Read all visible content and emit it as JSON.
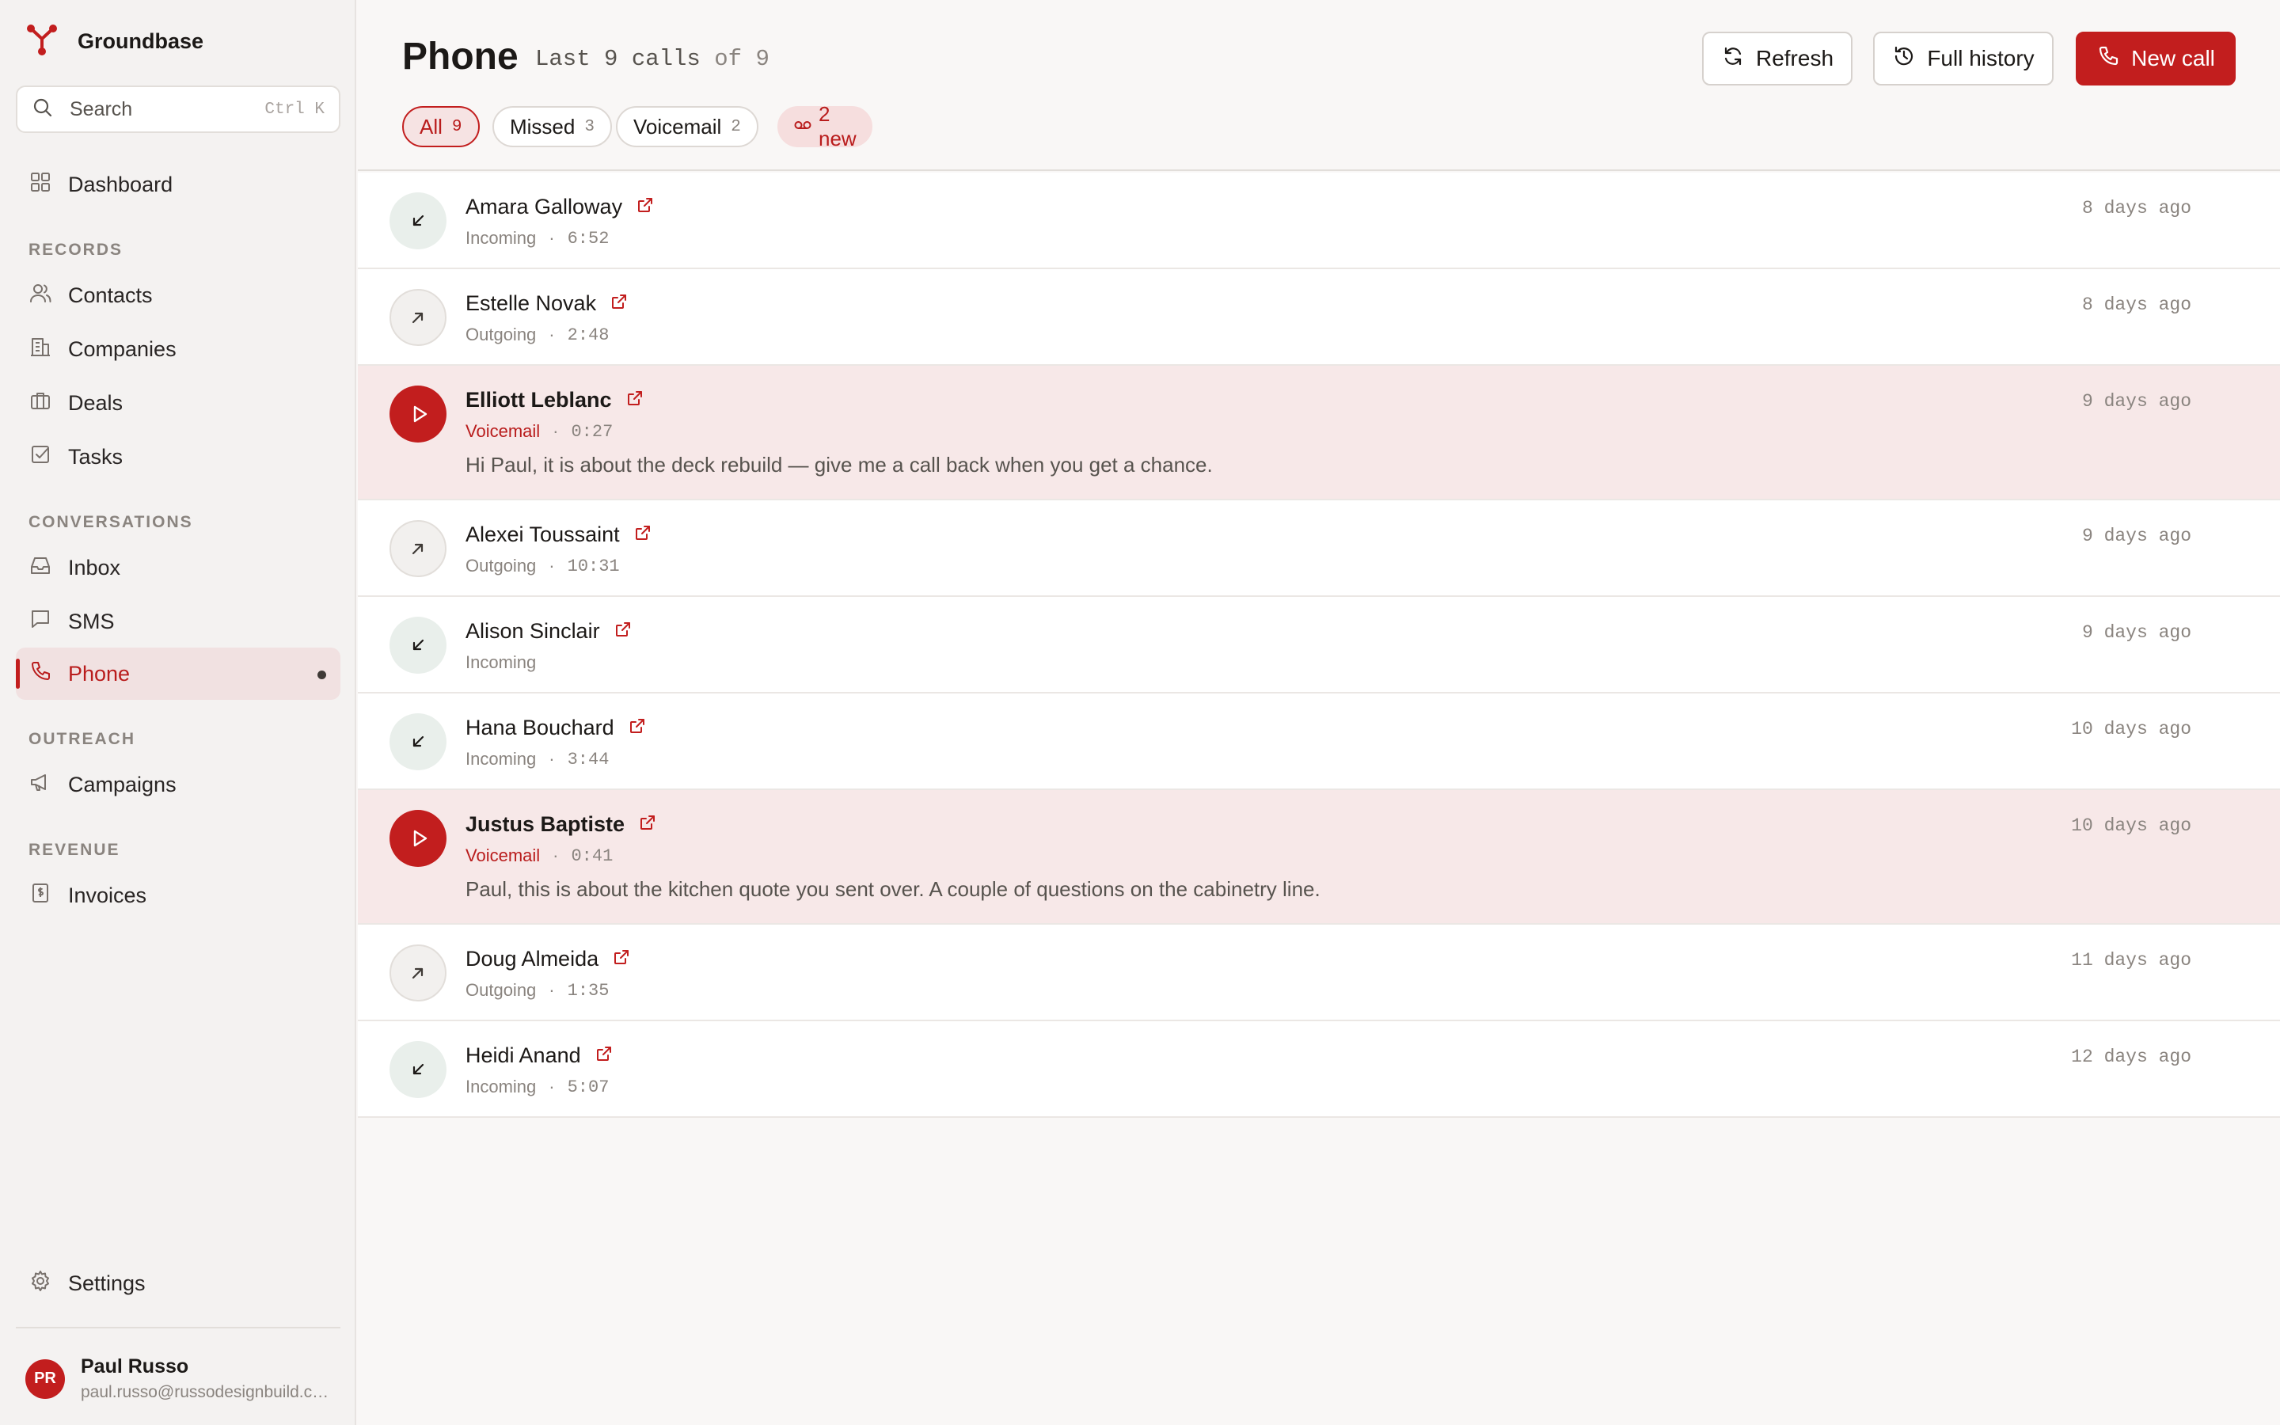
{
  "app": {
    "brand": "Groundbase"
  },
  "search": {
    "placeholder": "Search",
    "shortcut": "Ctrl K"
  },
  "sidebar": {
    "dashboard": "Dashboard",
    "sections": {
      "records": "RECORDS",
      "conversations": "CONVERSATIONS",
      "outreach": "OUTREACH",
      "revenue": "REVENUE"
    },
    "items": {
      "contacts": "Contacts",
      "companies": "Companies",
      "deals": "Deals",
      "tasks": "Tasks",
      "inbox": "Inbox",
      "sms": "SMS",
      "phone": "Phone",
      "campaigns": "Campaigns",
      "invoices": "Invoices",
      "settings": "Settings"
    }
  },
  "user": {
    "initials": "PR",
    "name": "Paul Russo",
    "email": "paul.russo@russodesignbuild.com"
  },
  "header": {
    "title": "Phone",
    "subtitle": "Last 9 calls",
    "subtitle_of": "of 9",
    "refresh": "Refresh",
    "history": "Full history",
    "new_call": "New call"
  },
  "filters": {
    "all": {
      "label": "All",
      "count": "9"
    },
    "missed": {
      "label": "Missed",
      "count": "3"
    },
    "voicemail": {
      "label": "Voicemail",
      "count": "2"
    },
    "new": "2 new"
  },
  "colors": {
    "accent": "#c21e1e",
    "voicemail_row": "#f7e8e8",
    "incoming_icon_bg": "#e9efeb"
  },
  "calls": [
    {
      "name": "Amara Galloway",
      "type": "Incoming",
      "direction": "incoming",
      "duration": "6:52",
      "when": "8 days ago"
    },
    {
      "name": "Estelle Novak",
      "type": "Outgoing",
      "direction": "outgoing",
      "duration": "2:48",
      "when": "8 days ago"
    },
    {
      "name": "Elliott Leblanc",
      "type": "Voicemail",
      "direction": "voicemail",
      "duration": "0:27",
      "when": "9 days ago",
      "transcript": "Hi Paul, it is about the deck rebuild — give me a call back when you get a chance."
    },
    {
      "name": "Alexei Toussaint",
      "type": "Outgoing",
      "direction": "outgoing",
      "duration": "10:31",
      "when": "9 days ago"
    },
    {
      "name": "Alison Sinclair",
      "type": "Incoming",
      "direction": "incoming",
      "duration": "",
      "when": "9 days ago"
    },
    {
      "name": "Hana Bouchard",
      "type": "Incoming",
      "direction": "incoming",
      "duration": "3:44",
      "when": "10 days ago"
    },
    {
      "name": "Justus Baptiste",
      "type": "Voicemail",
      "direction": "voicemail",
      "duration": "0:41",
      "when": "10 days ago",
      "transcript": "Paul, this is about the kitchen quote you sent over. A couple of questions on the cabinetry line."
    },
    {
      "name": "Doug Almeida",
      "type": "Outgoing",
      "direction": "outgoing",
      "duration": "1:35",
      "when": "11 days ago"
    },
    {
      "name": "Heidi Anand",
      "type": "Incoming",
      "direction": "incoming",
      "duration": "5:07",
      "when": "12 days ago"
    }
  ]
}
